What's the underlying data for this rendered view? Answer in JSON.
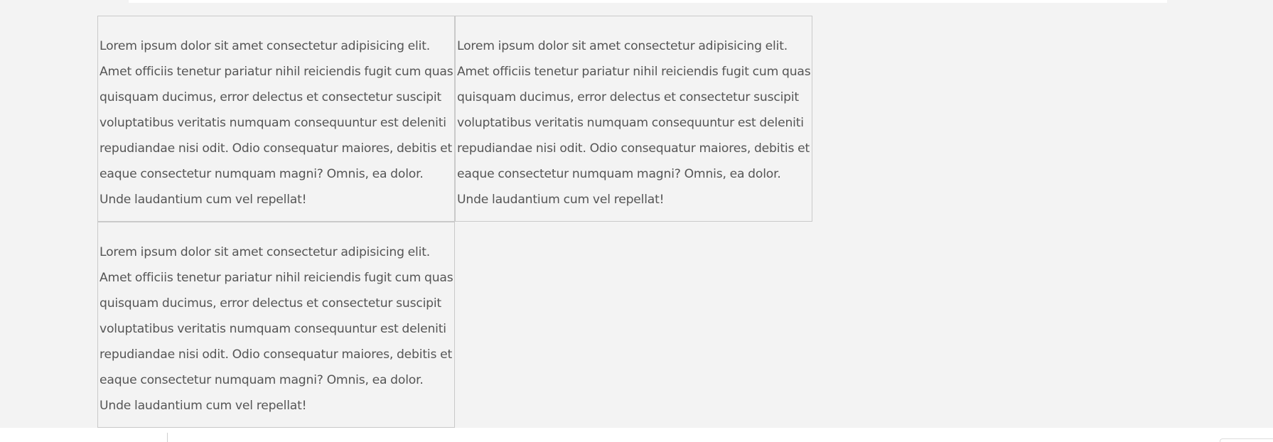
{
  "cards": [
    {
      "text": "Lorem ipsum dolor sit amet consectetur adipisicing elit. Amet officiis tenetur pariatur nihil reiciendis fugit cum quas quisquam ducimus, error delectus et consectetur suscipit voluptatibus veritatis numquam consequuntur est deleniti repudiandae nisi odit. Odio consequatur maiores, debitis et eaque consectetur numquam magni? Omnis, ea dolor. Unde laudantium cum vel repellat!"
    },
    {
      "text": "Lorem ipsum dolor sit amet consectetur adipisicing elit. Amet officiis tenetur pariatur nihil reiciendis fugit cum quas quisquam ducimus, error delectus et consectetur suscipit voluptatibus veritatis numquam consequuntur est deleniti repudiandae nisi odit. Odio consequatur maiores, debitis et eaque consectetur numquam magni? Omnis, ea dolor. Unde laudantium cum vel repellat!"
    },
    {
      "text": "Lorem ipsum dolor sit amet consectetur adipisicing elit. Amet officiis tenetur pariatur nihil reiciendis fugit cum quas quisquam ducimus, error delectus et consectetur suscipit voluptatibus veritatis numquam consequuntur est deleniti repudiandae nisi odit. Odio consequatur maiores, debitis et eaque consectetur numquam magni? Omnis, ea dolor. Unde laudantium cum vel repellat!"
    }
  ],
  "colors": {
    "page_background": "#f3f3f3",
    "card_border": "#c9c9c9",
    "text": "#555555",
    "bar_background": "#ffffff"
  }
}
